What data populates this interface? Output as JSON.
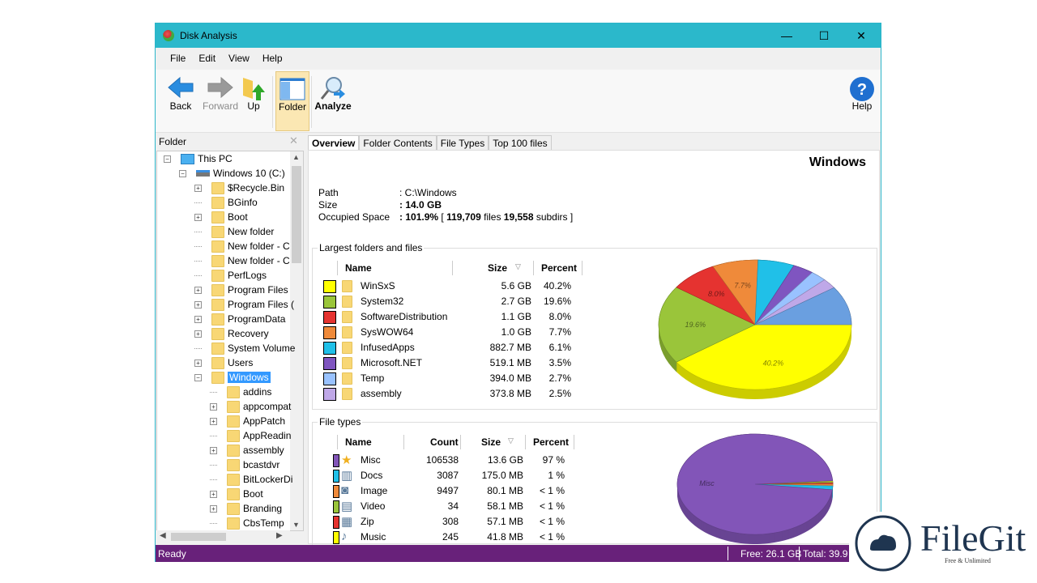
{
  "window": {
    "title": "Disk Analysis",
    "minimize": "—",
    "maximize": "☐",
    "close": "✕"
  },
  "menu": [
    "File",
    "Edit",
    "View",
    "Help"
  ],
  "toolbar": {
    "back": "Back",
    "forward": "Forward",
    "up": "Up",
    "folder": "Folder",
    "analyze": "Analyze",
    "help": "Help"
  },
  "left": {
    "title": "Folder",
    "close": "✕",
    "tree": [
      {
        "label": "This PC",
        "level": 0,
        "exp": "−",
        "icon": "computer"
      },
      {
        "label": "Windows 10 (C:)",
        "level": 1,
        "exp": "−",
        "icon": "drive"
      },
      {
        "label": "$Recycle.Bin",
        "level": 2,
        "exp": "+"
      },
      {
        "label": "BGinfo",
        "level": 2,
        "exp": ""
      },
      {
        "label": "Boot",
        "level": 2,
        "exp": "+"
      },
      {
        "label": "New folder",
        "level": 2,
        "exp": ""
      },
      {
        "label": "New folder - C",
        "level": 2,
        "exp": ""
      },
      {
        "label": "New folder - C",
        "level": 2,
        "exp": ""
      },
      {
        "label": "PerfLogs",
        "level": 2,
        "exp": ""
      },
      {
        "label": "Program Files",
        "level": 2,
        "exp": "+"
      },
      {
        "label": "Program Files (",
        "level": 2,
        "exp": "+"
      },
      {
        "label": "ProgramData",
        "level": 2,
        "exp": "+"
      },
      {
        "label": "Recovery",
        "level": 2,
        "exp": "+"
      },
      {
        "label": "System Volume",
        "level": 2,
        "exp": ""
      },
      {
        "label": "Users",
        "level": 2,
        "exp": "+"
      },
      {
        "label": "Windows",
        "level": 2,
        "exp": "−",
        "selected": true
      },
      {
        "label": "addins",
        "level": 3,
        "exp": ""
      },
      {
        "label": "appcompat",
        "level": 3,
        "exp": "+"
      },
      {
        "label": "AppPatch",
        "level": 3,
        "exp": "+"
      },
      {
        "label": "AppReadin",
        "level": 3,
        "exp": ""
      },
      {
        "label": "assembly",
        "level": 3,
        "exp": "+"
      },
      {
        "label": "bcastdvr",
        "level": 3,
        "exp": ""
      },
      {
        "label": "BitLockerDi",
        "level": 3,
        "exp": ""
      },
      {
        "label": "Boot",
        "level": 3,
        "exp": "+"
      },
      {
        "label": "Branding",
        "level": 3,
        "exp": "+"
      },
      {
        "label": "CbsTemp",
        "level": 3,
        "exp": ""
      }
    ]
  },
  "tabs": [
    {
      "label": "Overview",
      "active": true
    },
    {
      "label": "Folder Contents"
    },
    {
      "label": "File Types"
    },
    {
      "label": "Top 100 files"
    }
  ],
  "overview": {
    "title": "Windows",
    "path_label": "Path",
    "path": ": C:\\Windows",
    "size_label": "Size",
    "size": ": 14.0 GB",
    "occ_label": "Occupied Space",
    "occ_prefix": ": ",
    "occ_pct": "101.9%",
    "occ_mid1": " [ ",
    "files": "119,709",
    "occ_mid2": " files ",
    "subdirs": "19,558",
    "occ_end": " subdirs ]"
  },
  "largest": {
    "title": "Largest folders and files",
    "headers": {
      "name": "Name",
      "size": "Size",
      "percent": "Percent"
    },
    "sort_icon": "▽",
    "rows": [
      {
        "name": "WinSxS",
        "size": "5.6 GB",
        "percent": "40.2%",
        "value": 40.2,
        "color": "#ffff00"
      },
      {
        "name": "System32",
        "size": "2.7 GB",
        "percent": "19.6%",
        "value": 19.6,
        "color": "#9ac53a"
      },
      {
        "name": "SoftwareDistribution",
        "size": "1.1 GB",
        "percent": "8.0%",
        "value": 8.0,
        "color": "#e53330"
      },
      {
        "name": "SysWOW64",
        "size": "1.0 GB",
        "percent": "7.7%",
        "value": 7.7,
        "color": "#ef8a3a"
      },
      {
        "name": "InfusedApps",
        "size": "882.7 MB",
        "percent": "6.1%",
        "value": 6.1,
        "color": "#20c0e8"
      },
      {
        "name": "Microsoft.NET",
        "size": "519.1 MB",
        "percent": "3.5%",
        "value": 3.5,
        "color": "#7f55c0"
      },
      {
        "name": "Temp",
        "size": "394.0 MB",
        "percent": "2.7%",
        "value": 2.7,
        "color": "#99c2ff"
      },
      {
        "name": "assembly",
        "size": "373.8 MB",
        "percent": "2.5%",
        "value": 2.5,
        "color": "#bfa8e8"
      }
    ],
    "other_color": "#6a9fe0"
  },
  "filetypes": {
    "title": "File types",
    "headers": {
      "name": "Name",
      "count": "Count",
      "size": "Size",
      "percent": "Percent"
    },
    "sort_icon": "▽",
    "rows": [
      {
        "name": "Misc",
        "count": "106538",
        "size": "13.6 GB",
        "percent": "97 %",
        "value": 13926,
        "color": "#8255b8",
        "icon": "star"
      },
      {
        "name": "Docs",
        "count": "3087",
        "size": "175.0 MB",
        "percent": "1 %",
        "value": 175.0,
        "color": "#20c0e8",
        "icon": "book"
      },
      {
        "name": "Image",
        "count": "9497",
        "size": "80.1 MB",
        "percent": "< 1 %",
        "value": 80.1,
        "color": "#ef8a3a",
        "icon": "camera"
      },
      {
        "name": "Video",
        "count": "34",
        "size": "58.1 MB",
        "percent": "< 1 %",
        "value": 58.1,
        "color": "#9ac53a",
        "icon": "film"
      },
      {
        "name": "Zip",
        "count": "308",
        "size": "57.1 MB",
        "percent": "< 1 %",
        "value": 57.1,
        "color": "#e53330",
        "icon": "zip"
      },
      {
        "name": "Music",
        "count": "245",
        "size": "41.8 MB",
        "percent": "< 1 %",
        "value": 41.8,
        "color": "#ffff00",
        "icon": "music"
      }
    ]
  },
  "status": {
    "text": "Ready",
    "free": "Free: 26.1 GB",
    "total": "Total: 39.9"
  },
  "watermark": {
    "name": "FileGit",
    "tagline": "Free & Unlimited"
  },
  "colors": {
    "titlebar": "#2bb8cb",
    "statusbar": "#68217a",
    "selection": "#3399ff"
  }
}
